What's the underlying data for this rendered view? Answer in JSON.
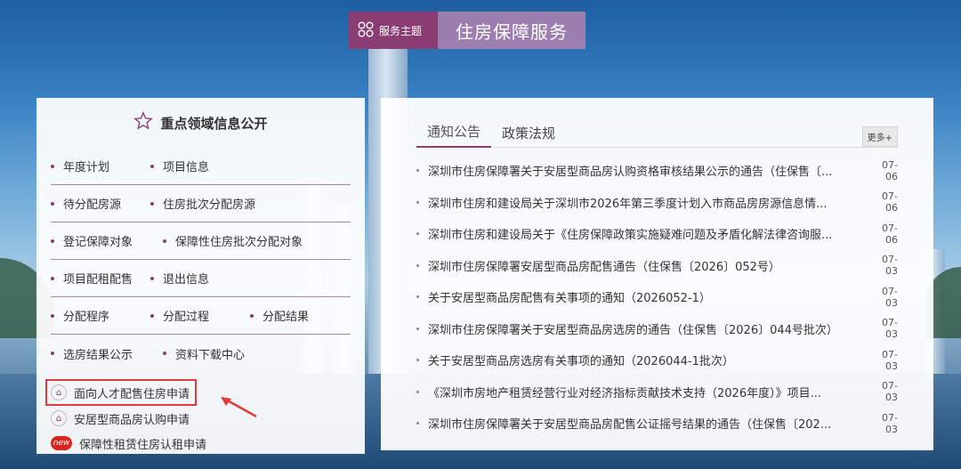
{
  "banner": {
    "tag": "服务主题",
    "title": "住房保障服务",
    "accent": "#8a3d72"
  },
  "left": {
    "title": "重点领域信息公开",
    "rows": [
      [
        "年度计划",
        "项目信息"
      ],
      [
        "待分配房源",
        "住房批次分配房源"
      ],
      [
        "登记保障对象",
        "保障性住房批次分配对象"
      ],
      [
        "项目配租配售",
        "退出信息"
      ],
      [
        "分配程序",
        "分配过程",
        "分配结果"
      ],
      [
        "选房结果公示",
        "资料下载中心"
      ]
    ],
    "applications": [
      "面向人才配售住房申请",
      "安居型商品房认购申请",
      "保障性租赁住房认租申请"
    ],
    "new_badge": "new"
  },
  "right": {
    "tabs": [
      "通知公告",
      "政策法规"
    ],
    "more": "更多+",
    "news": [
      {
        "title": "深圳市住房保障署关于安居型商品房认购资格审核结果公示的通告（住保售〔...",
        "date": "07-06"
      },
      {
        "title": "深圳市住房和建设局关于深圳市2026年第三季度计划入市商品房房源信息情...",
        "date": "07-06"
      },
      {
        "title": "深圳市住房和建设局关于《住房保障政策实施疑难问题及矛盾化解法律咨询服...",
        "date": "07-06"
      },
      {
        "title": "深圳市住房保障署安居型商品房配售通告（住保售〔2026〕052号）",
        "date": "07-03"
      },
      {
        "title": "关于安居型商品房配售有关事项的通知（2026052-1）",
        "date": "07-03"
      },
      {
        "title": "深圳市住房保障署关于安居型商品房选房的通告（住保售〔2026〕044号批次）",
        "date": "07-03"
      },
      {
        "title": "关于安居型商品房选房有关事项的通知（2026044-1批次）",
        "date": "07-03"
      },
      {
        "title": "《深圳市房地产租赁经营行业对经济指标贡献技术支持（2026年度）》项目...",
        "date": "07-03"
      },
      {
        "title": "深圳市住房保障署关于安居型商品房配售公证摇号结果的通告（住保售〔202...",
        "date": "07-03"
      }
    ]
  }
}
